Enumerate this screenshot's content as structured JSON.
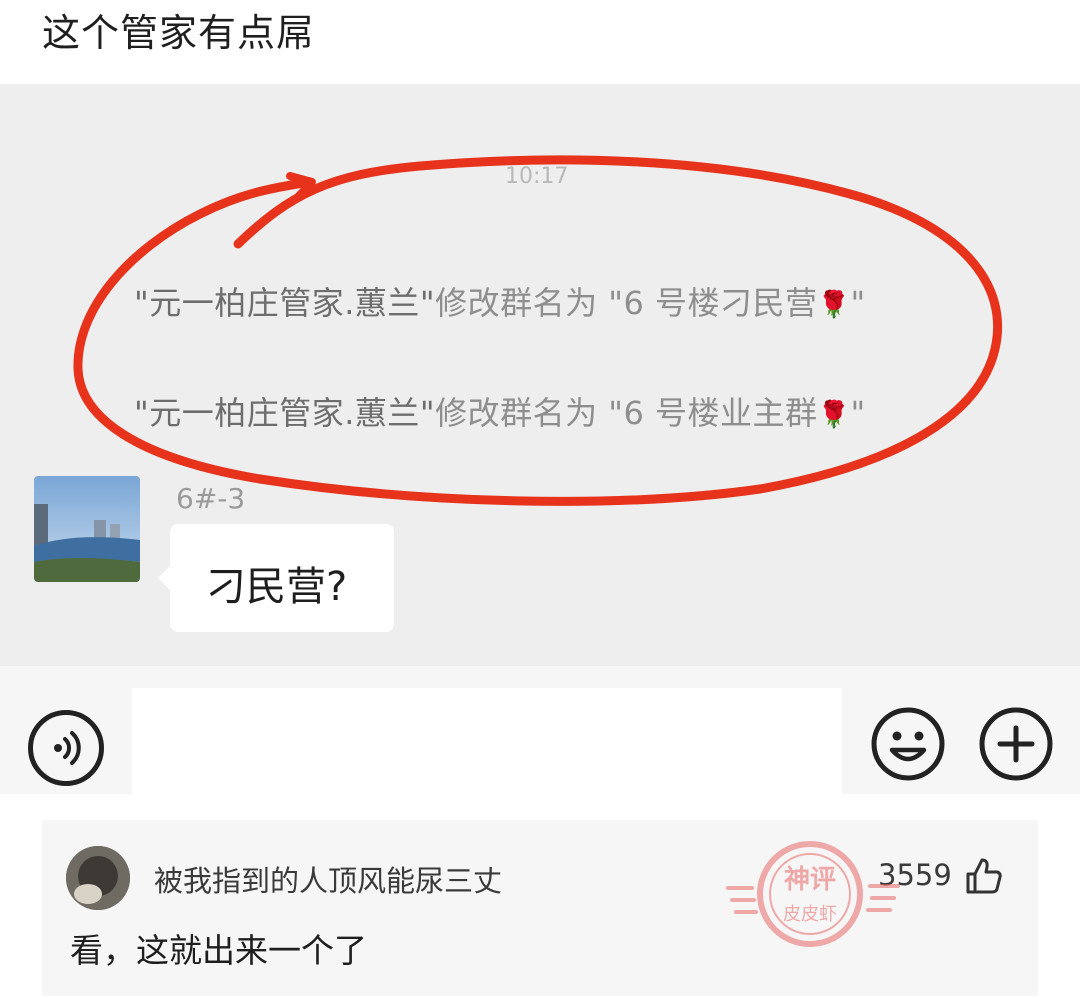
{
  "post": {
    "title": "这个管家有点屌"
  },
  "chat": {
    "timestamp": "10:17",
    "system_messages": [
      {
        "actor": "\"元一柏庄管家.蕙兰\"",
        "action": "修改群名为 \"6 号楼刁民营",
        "icon": "rose-emoji",
        "close": "\""
      },
      {
        "actor": "\"元一柏庄管家.蕙兰\"",
        "action": "修改群名为 \"6 号楼业主群",
        "icon": "rose-emoji",
        "close": "\""
      }
    ],
    "message": {
      "sender": "6#-3",
      "text": "刁民营?"
    },
    "input_bar": {
      "voice_icon": "voice-icon",
      "emoji_icon": "emoji-icon",
      "plus_icon": "plus-icon"
    }
  },
  "comment": {
    "author": "被我指到的人顶风能尿三丈",
    "likes": "3559",
    "text": "看，这就出来一个了",
    "like_icon": "thumbs-up-icon"
  },
  "watermark": {
    "line1": "神评",
    "line2": "皮皮虾"
  },
  "colors": {
    "annotation": "#e8331c",
    "chat_bg": "#eeeeee",
    "card_bg": "#f6f6f6"
  }
}
